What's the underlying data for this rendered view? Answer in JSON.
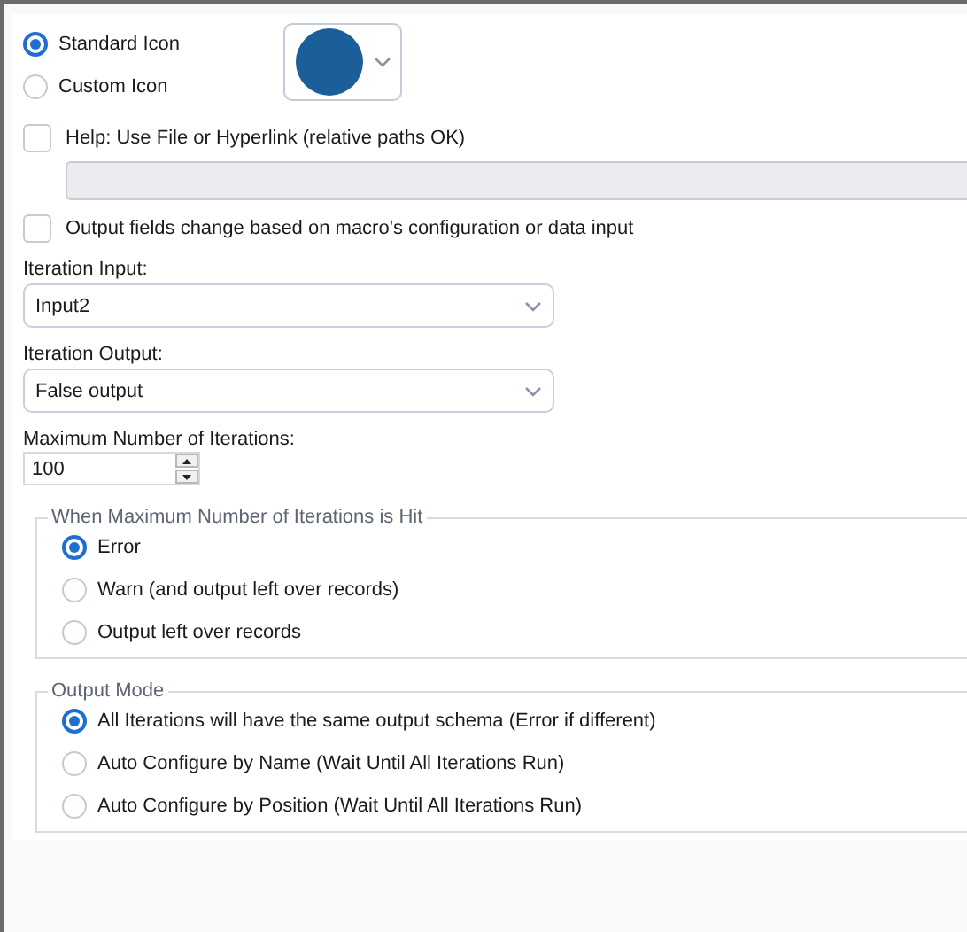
{
  "icon_choice": [
    {
      "label": "Standard Icon",
      "selected": true
    },
    {
      "label": "Custom Icon",
      "selected": false
    }
  ],
  "icon_picker": {
    "color": "#1a5e9a"
  },
  "help": {
    "label": "Help: Use File or Hyperlink (relative paths OK)",
    "checked": false,
    "disabled": true
  },
  "output_fields": {
    "label": "Output fields change based on macro's configuration or data input",
    "checked": false
  },
  "iteration_input": {
    "label": "Iteration Input:",
    "value": "Input2"
  },
  "iteration_output": {
    "label": "Iteration Output:",
    "value": "False output"
  },
  "max_iterations": {
    "label": "Maximum Number of Iterations:",
    "value": "100"
  },
  "groups": [
    {
      "title": "When Maximum Number of Iterations is Hit",
      "options": [
        {
          "label": "Error",
          "selected": true
        },
        {
          "label": "Warn (and output left over records)",
          "selected": false
        },
        {
          "label": "Output left over records",
          "selected": false
        }
      ]
    },
    {
      "title": "Output Mode",
      "options": [
        {
          "label": "All Iterations will have the same output schema (Error if different)",
          "selected": true
        },
        {
          "label": "Auto Configure by Name (Wait Until All Iterations Run)",
          "selected": false
        },
        {
          "label": "Auto Configure by Position (Wait Until All Iterations Run)",
          "selected": false
        }
      ]
    }
  ]
}
